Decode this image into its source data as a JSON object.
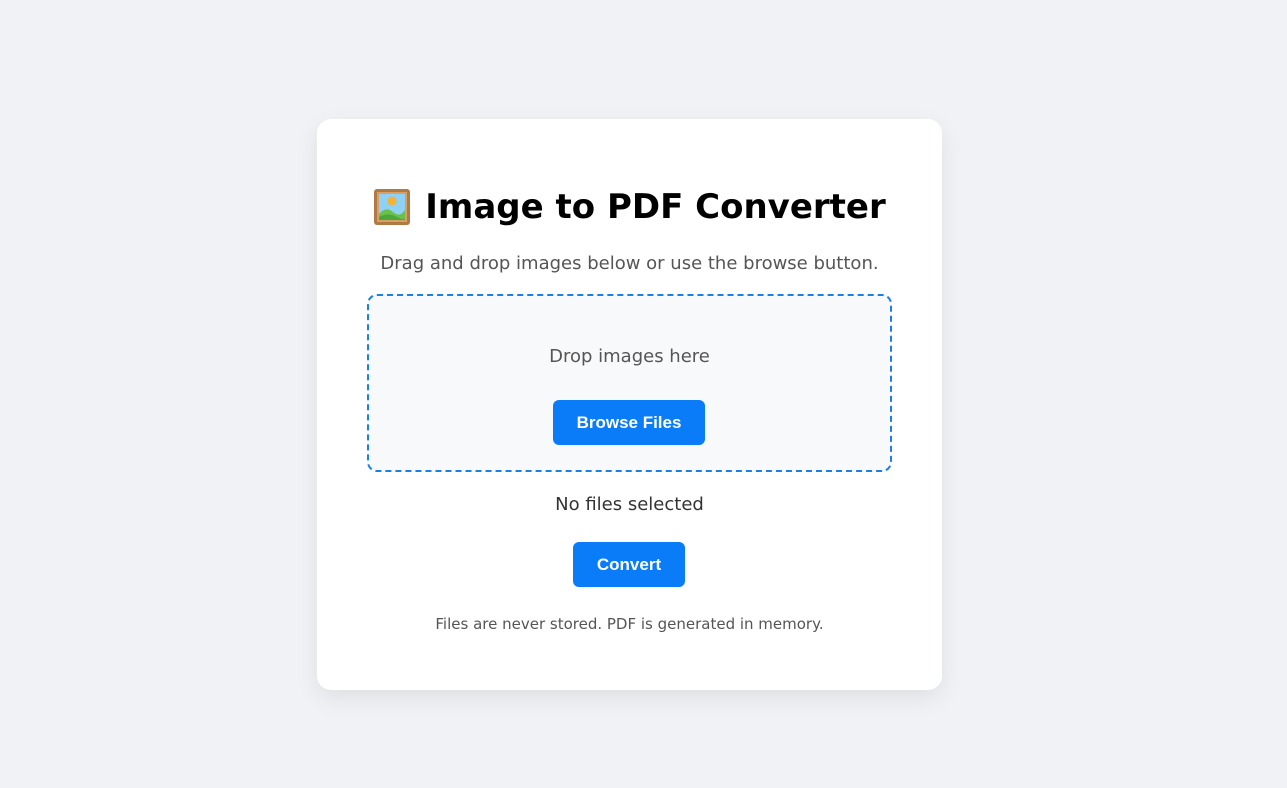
{
  "header": {
    "title": "Image to PDF Converter",
    "icon": "framed-picture-icon",
    "subtitle": "Drag and drop images below or use the browse button."
  },
  "dropzone": {
    "label": "Drop images here",
    "browse_label": "Browse Files"
  },
  "status": {
    "files_text": "No files selected"
  },
  "actions": {
    "convert_label": "Convert"
  },
  "footer": {
    "note": "Files are never stored. PDF is generated in memory."
  },
  "colors": {
    "accent": "#0a7cf7",
    "background": "#f0f2f5",
    "card": "#ffffff",
    "dropzone_border": "#1a7fe6"
  }
}
